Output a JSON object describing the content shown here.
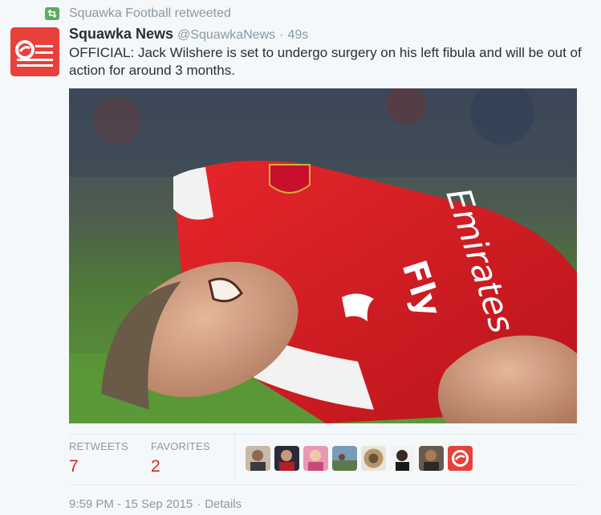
{
  "retweet": {
    "icon": "retweet-icon",
    "text": "Squawka Football retweeted"
  },
  "tweet": {
    "avatar_icon": "squawka-logo-icon",
    "fullname": "Squawka News",
    "username": "@SquawkaNews",
    "separator": "·",
    "time": "49s",
    "text": "OFFICIAL: Jack Wilshere is set to undergo surgery on his left fibula and will be out of action for around 3 months.",
    "photo": {
      "jersey_text_1": "Fly",
      "jersey_text_2": "Emirates"
    }
  },
  "stats": {
    "retweets_label": "RETWEETS",
    "retweets_value": "7",
    "favorites_label": "FAVORITES",
    "favorites_value": "2"
  },
  "footer": {
    "datetime": "9:59 PM - 15 Sep 2015",
    "separator": "·",
    "details": "Details"
  },
  "colors": {
    "brand_red": "#e8403b",
    "count_red": "#d9251c",
    "retweet_green": "#5cae5c",
    "meta_gray": "#8899a6"
  }
}
